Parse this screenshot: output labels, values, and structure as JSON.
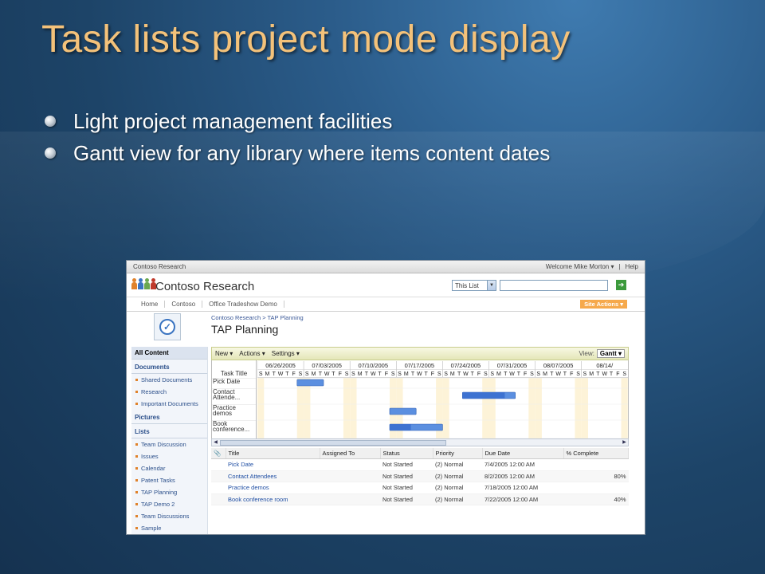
{
  "slide": {
    "title": "Task lists project mode display",
    "bullets": [
      "Light project management facilities",
      "Gantt view for any library where items content dates"
    ]
  },
  "screenshot": {
    "top_bar": {
      "site": "Contoso Research",
      "welcome": "Welcome Mike Morton ▾",
      "separator": "|",
      "help": "Help"
    },
    "header": {
      "site_name": "Contoso Research",
      "search_scope": "This List",
      "search_placeholder": "",
      "go_icon": "go-arrow-icon"
    },
    "nav_tabs": [
      "Home",
      "Contoso",
      "Office Tradeshow Demo"
    ],
    "site_actions": "Site Actions ▾",
    "breadcrumb": "Contoso Research > TAP Planning",
    "page_title": "TAP Planning",
    "quick_launch": {
      "all_content": "All Content",
      "documents_heading": "Documents",
      "documents": [
        "Shared Documents",
        "Research",
        "Important Documents"
      ],
      "pictures_heading": "Pictures",
      "lists_heading": "Lists",
      "lists": [
        "Team Discussion",
        "Issues",
        "Calendar",
        "Patent Tasks",
        "TAP Planning",
        "TAP Demo 2",
        "Team Discussions",
        "Sample"
      ]
    },
    "toolbar": {
      "new": "New ▾",
      "actions": "Actions ▾",
      "settings": "Settings ▾",
      "view_label": "View:",
      "view_value": "Gantt ▾"
    },
    "gantt": {
      "task_title_header": "Task Title",
      "weeks": [
        "06/26/2005",
        "07/03/2005",
        "07/10/2005",
        "07/17/2005",
        "07/24/2005",
        "07/31/2005",
        "08/07/2005",
        "08/14/"
      ],
      "day_letters": [
        "S",
        "M",
        "T",
        "W",
        "T",
        "F",
        "S"
      ],
      "rows": [
        "Pick Date",
        "Contact Attende...",
        "Practice demos",
        "Book conference..."
      ],
      "bar_color": "#5b8fe0"
    },
    "task_table": {
      "columns": [
        "",
        "Title",
        "Assigned To",
        "Status",
        "Priority",
        "Due Date",
        "% Complete"
      ],
      "rows": [
        {
          "title": "Pick Date",
          "assigned": "",
          "status": "Not Started",
          "priority": "(2) Normal",
          "due": "7/4/2005 12:00 AM",
          "complete": ""
        },
        {
          "title": "Contact Attendees",
          "assigned": "",
          "status": "Not Started",
          "priority": "(2) Normal",
          "due": "8/2/2005 12:00 AM",
          "complete": "80%"
        },
        {
          "title": "Practice demos",
          "assigned": "",
          "status": "Not Started",
          "priority": "(2) Normal",
          "due": "7/18/2005 12:00 AM",
          "complete": ""
        },
        {
          "title": "Book conference room",
          "assigned": "",
          "status": "Not Started",
          "priority": "(2) Normal",
          "due": "7/22/2005 12:00 AM",
          "complete": "40%"
        }
      ]
    }
  }
}
